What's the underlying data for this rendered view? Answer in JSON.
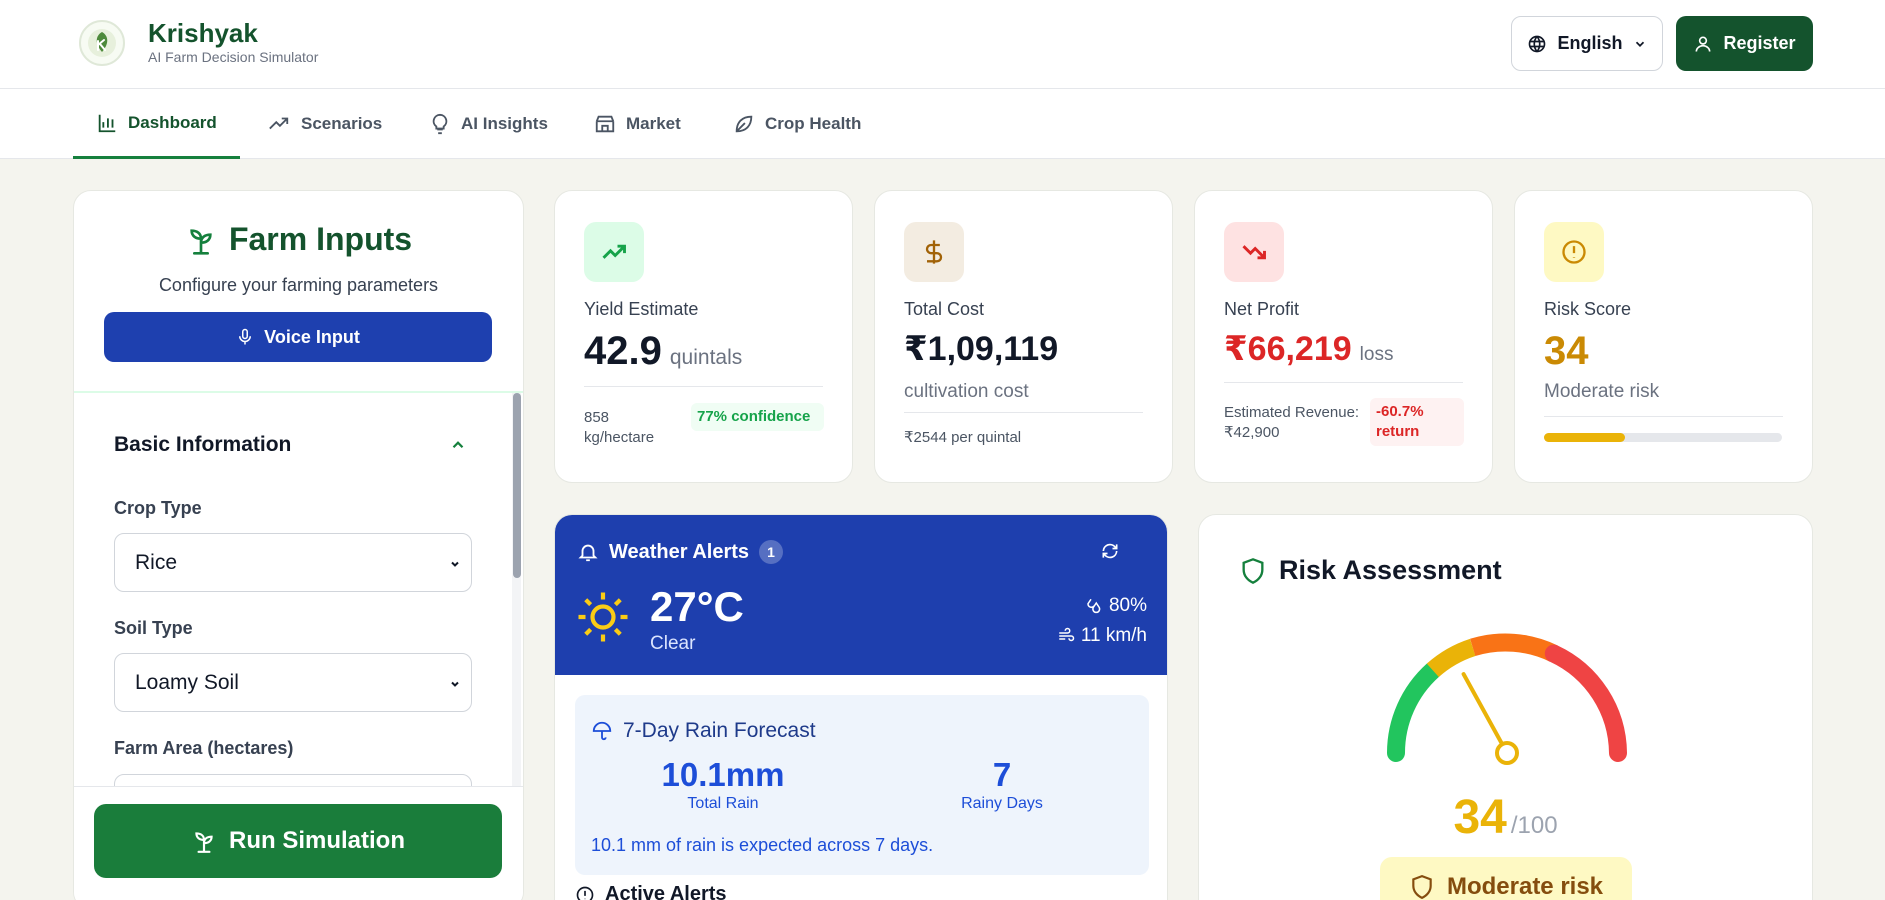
{
  "header": {
    "brand_name": "Krishyak",
    "tagline": "AI Farm Decision Simulator",
    "language": "English",
    "register_label": "Register"
  },
  "nav": {
    "tabs": [
      {
        "label": "Dashboard",
        "icon": "bar-chart-icon",
        "active": true
      },
      {
        "label": "Scenarios",
        "icon": "trending-up-icon",
        "active": false
      },
      {
        "label": "AI Insights",
        "icon": "lightbulb-icon",
        "active": false
      },
      {
        "label": "Market",
        "icon": "store-icon",
        "active": false
      },
      {
        "label": "Crop Health",
        "icon": "leaf-icon",
        "active": false
      }
    ]
  },
  "farm_inputs": {
    "title": "Farm Inputs",
    "subtitle": "Configure your farming parameters",
    "voice_label": "Voice Input",
    "section_title": "Basic Information",
    "crop_type_label": "Crop Type",
    "crop_type_value": "Rice",
    "soil_type_label": "Soil Type",
    "soil_type_value": "Loamy Soil",
    "farm_area_label": "Farm Area (hectares)",
    "run_label": "Run Simulation"
  },
  "stats": {
    "yield": {
      "label": "Yield Estimate",
      "value": "42.9",
      "unit": "quintals",
      "foot": "858 kg/hectare",
      "badge": "77% confidence"
    },
    "cost": {
      "label": "Total Cost",
      "value": "₹1,09,119",
      "sub": "cultivation cost",
      "foot": "₹2544 per quintal"
    },
    "profit": {
      "label": "Net Profit",
      "value": "₹66,219",
      "unit": "loss",
      "foot_label": "Estimated Revenue:",
      "foot_value": "₹42,900",
      "badge": "-60.7% return"
    },
    "risk": {
      "label": "Risk Score",
      "value": "34",
      "sub": "Moderate risk",
      "progress": 0.34
    }
  },
  "weather": {
    "title": "Weather Alerts",
    "alert_count": "1",
    "temperature": "27°C",
    "condition": "Clear",
    "humidity": "80%",
    "wind": "11 km/h",
    "rain_title": "7-Day Rain Forecast",
    "total_rain": "10.1mm",
    "total_rain_label": "Total Rain",
    "rainy_days": "7",
    "rainy_days_label": "Rainy Days",
    "rain_note": "10.1 mm of rain is expected across 7 days.",
    "active_alerts": "Active Alerts"
  },
  "risk_assessment": {
    "title": "Risk Assessment",
    "score": "34",
    "max": "/100",
    "level": "Moderate risk",
    "score_value": 34
  },
  "colors": {
    "brand_green": "#14532d",
    "run_green": "#1a7d3b",
    "voice_blue": "#1e40af",
    "weather_blue": "#1e3fae",
    "loss_red": "#dc2626",
    "risk_amber": "#ca8a04"
  }
}
